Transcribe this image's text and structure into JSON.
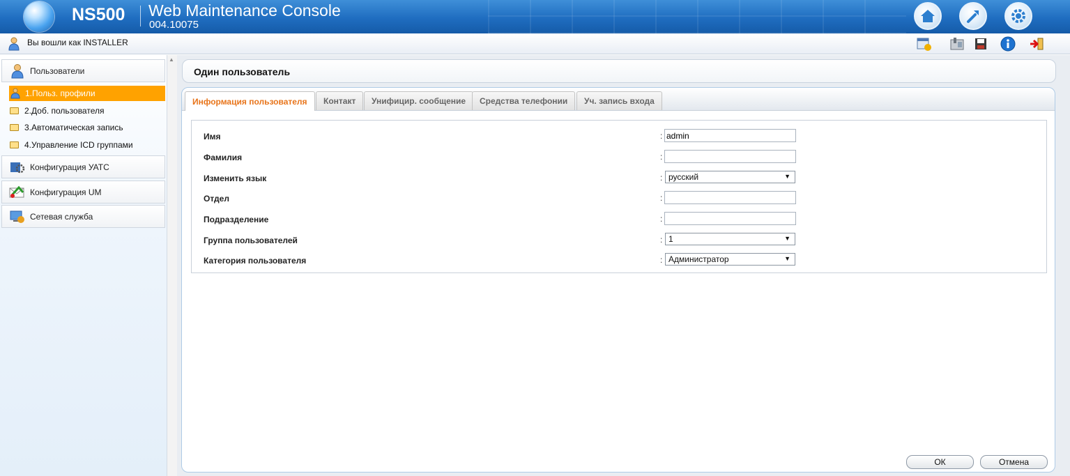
{
  "header": {
    "product": "NS500",
    "console_title": "Web Maintenance Console",
    "version": "004.10075",
    "buttons": [
      "home-icon",
      "wrench-icon",
      "gear-icon"
    ]
  },
  "subbar": {
    "login_text": "Вы вошли как INSTALLER",
    "tools": [
      "calendar-alert-icon",
      "phone-icon",
      "save-icon",
      "info-icon",
      "logout-icon"
    ]
  },
  "sidebar": {
    "categories": [
      {
        "label": "Пользователи",
        "icon": "user-icon"
      },
      {
        "label": "Конфигурация УАТС",
        "icon": "pbx-config-icon"
      },
      {
        "label": "Конфигурация UM",
        "icon": "um-config-icon"
      },
      {
        "label": "Сетевая служба",
        "icon": "network-service-icon"
      }
    ],
    "items": [
      {
        "label": "1.Польз. профили",
        "active": true
      },
      {
        "label": "2.Доб. пользователя",
        "active": false
      },
      {
        "label": "3.Автоматическая запись",
        "active": false
      },
      {
        "label": "4.Управление ICD группами",
        "active": false
      }
    ]
  },
  "main": {
    "title": "Один пользователь",
    "tabs": [
      {
        "label": "Информация пользователя",
        "active": true
      },
      {
        "label": "Контакт",
        "active": false
      },
      {
        "label": "Унифицир. сообщение",
        "active": false
      },
      {
        "label": "Средства телефонии",
        "active": false
      },
      {
        "label": "Уч. запись входа",
        "active": false
      }
    ],
    "fields": {
      "name": {
        "label": "Имя",
        "value": "admin"
      },
      "surname": {
        "label": "Фамилия",
        "value": ""
      },
      "language": {
        "label": "Изменить язык",
        "value": "русский"
      },
      "department": {
        "label": "Отдел",
        "value": ""
      },
      "division": {
        "label": "Подразделение",
        "value": ""
      },
      "user_group": {
        "label": "Группа пользователей",
        "value": "1"
      },
      "user_category": {
        "label": "Категория пользователя",
        "value": "Администратор"
      }
    },
    "ok_label": "ОК",
    "cancel_label": "Отмена"
  },
  "colors": {
    "header_blue": "#1f6dc0",
    "active_item": "#ffa200",
    "active_tab_text": "#e8741a"
  }
}
